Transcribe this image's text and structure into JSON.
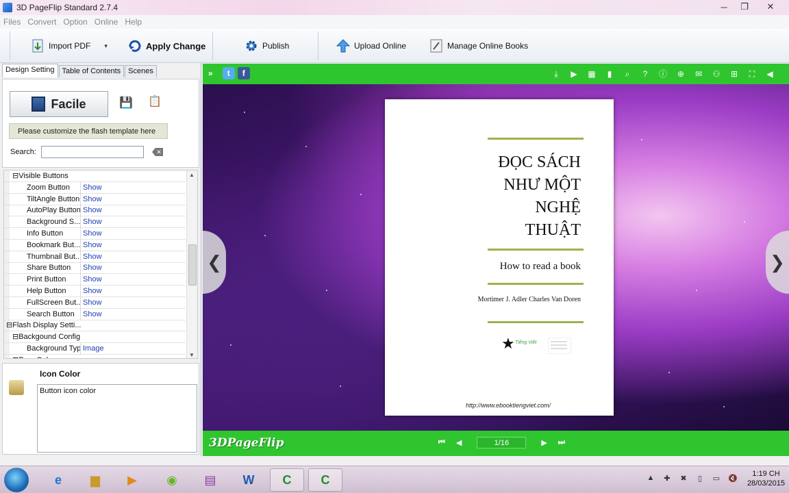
{
  "window": {
    "title": "3D PageFlip Standard 2.7.4",
    "controls": [
      "─",
      "❐",
      "✕"
    ]
  },
  "menu": [
    "Files",
    "Convert",
    "Option",
    "Online",
    "Help"
  ],
  "toolbar": {
    "import_pdf": "Import PDF",
    "apply_change": "Apply Change",
    "publish": "Publish",
    "upload_online": "Upload Online",
    "manage_online_books": "Manage Online Books"
  },
  "left_panel": {
    "tabs": [
      "Design Setting",
      "Table of Contents",
      "Scenes"
    ],
    "template_button": "Facile",
    "customize_text": "Please customize the flash template here",
    "search_label": "Search:",
    "search_value": "",
    "properties": [
      {
        "name": "⊟Visible Buttons",
        "value": "",
        "category": true
      },
      {
        "name": "Zoom Button",
        "value": "Show"
      },
      {
        "name": "TiltAngle Button",
        "value": "Show"
      },
      {
        "name": "AutoPlay Button",
        "value": "Show"
      },
      {
        "name": "Background S...",
        "value": "Show"
      },
      {
        "name": "Info Button",
        "value": "Show"
      },
      {
        "name": "Bookmark But...",
        "value": "Show"
      },
      {
        "name": "Thumbnail But...",
        "value": "Show"
      },
      {
        "name": "Share Button",
        "value": "Show"
      },
      {
        "name": "Print Button",
        "value": "Show"
      },
      {
        "name": "Help Button",
        "value": "Show"
      },
      {
        "name": "FullScreen But...",
        "value": "Show"
      },
      {
        "name": "Search Button",
        "value": "Show"
      },
      {
        "name": "⊟Flash Display Setti...",
        "value": "",
        "category": true
      },
      {
        "name": "⊟Backgound Config",
        "value": "",
        "category": true
      },
      {
        "name": "Background Type",
        "value": "Image"
      },
      {
        "name": "⊟Pure Color",
        "value": "",
        "category": true
      }
    ],
    "description": {
      "title": "Icon Color",
      "text": "Button icon color"
    }
  },
  "viewer": {
    "book": {
      "title": "ĐỌC SÁCH NHƯ MỘT NGHỆ THUẬT",
      "subtitle": "How to read a book",
      "authors": "Mortimer J. Adler Charles Van Doren",
      "logo_text": "Tiếng Việt",
      "url": "http://www.ebooktiengviet.com/"
    },
    "brand": "3DPageFlip",
    "page_indicator": "1/16",
    "nav_prev": "❮",
    "nav_next": "❯"
  },
  "taskbar": {
    "time": "1:19 CH",
    "date": "28/03/2015",
    "apps": [
      "ie-icon",
      "explorer-icon",
      "media-player-icon",
      "browser-icon",
      "winrar-icon",
      "word-icon",
      "camtasia-icon",
      "camtasia-recorder-icon"
    ]
  }
}
